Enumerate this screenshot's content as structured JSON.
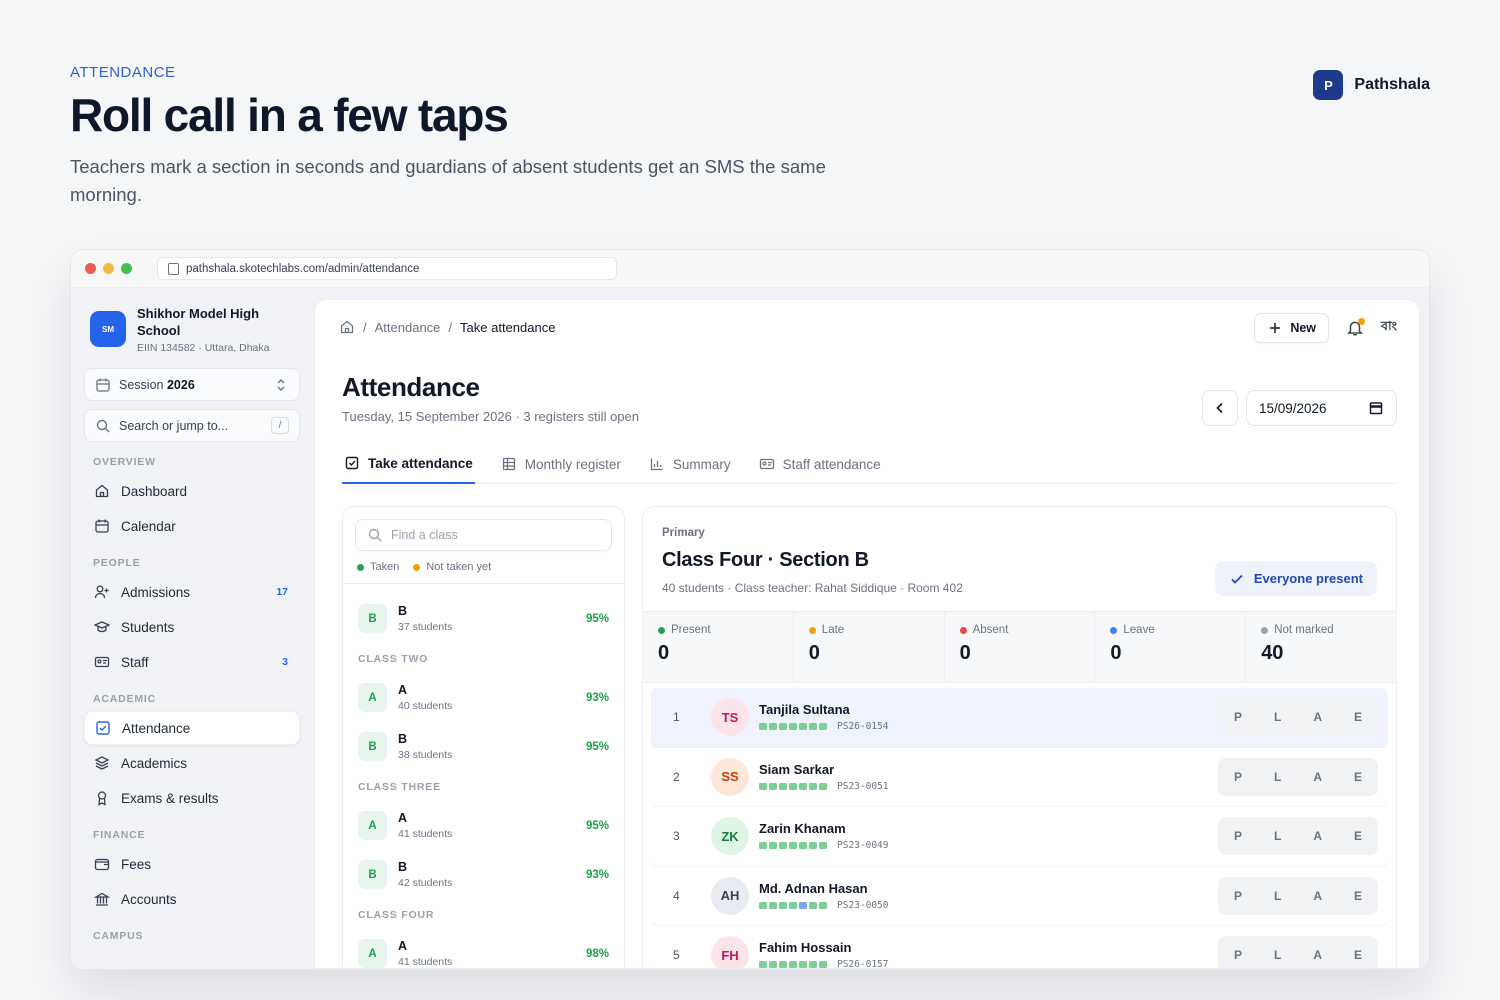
{
  "hero": {
    "eyebrow": "ATTENDANCE",
    "title": "Roll call in a few taps",
    "subtitle": "Teachers mark a section in seconds and guardians of absent students get an SMS the same morning."
  },
  "brand": {
    "logo_letter": "P",
    "name": "Pathshala"
  },
  "browser": {
    "url": "pathshala.skotechlabs.com/admin/attendance"
  },
  "sidebar": {
    "school": {
      "logo_text": "SM",
      "name": "Shikhor Model High School",
      "meta": "EIIN 134582 · Uttara, Dhaka"
    },
    "session": {
      "prefix": "Session",
      "value": "2026"
    },
    "search": {
      "placeholder": "Search or jump to...",
      "shortcut": "/"
    },
    "groups": {
      "overview": "OVERVIEW",
      "people": "PEOPLE",
      "academic": "ACADEMIC",
      "finance": "FINANCE",
      "campus": "CAMPUS"
    },
    "items": {
      "dashboard": "Dashboard",
      "calendar": "Calendar",
      "admissions": "Admissions",
      "admissions_badge": "17",
      "students": "Students",
      "staff": "Staff",
      "staff_badge": "3",
      "attendance": "Attendance",
      "academics": "Academics",
      "exams": "Exams & results",
      "fees": "Fees",
      "accounts": "Accounts"
    }
  },
  "header": {
    "breadcrumb": [
      "Attendance",
      "Take attendance"
    ],
    "new_label": "New",
    "lang_label": "বাং"
  },
  "page": {
    "title": "Attendance",
    "subtitle": "Tuesday, 15 September 2026 · 3 registers still open",
    "date": "15/09/2026"
  },
  "tabs": [
    "Take attendance",
    "Monthly register",
    "Summary",
    "Staff attendance"
  ],
  "classes": {
    "search_placeholder": "Find a class",
    "legend": {
      "taken": "Taken",
      "not_taken": "Not taken yet"
    },
    "colors": {
      "taken": "#22a55a",
      "not_taken": "#f59e0b"
    },
    "top_row": {
      "section": "B",
      "count": "37 students",
      "pct": "95%"
    },
    "groups": [
      {
        "name": "CLASS TWO",
        "rows": [
          {
            "section": "A",
            "count": "40 students",
            "pct": "93%"
          },
          {
            "section": "B",
            "count": "38 students",
            "pct": "95%"
          }
        ]
      },
      {
        "name": "CLASS THREE",
        "rows": [
          {
            "section": "A",
            "count": "41 students",
            "pct": "95%"
          },
          {
            "section": "B",
            "count": "42 students",
            "pct": "93%"
          }
        ]
      },
      {
        "name": "CLASS FOUR",
        "rows": [
          {
            "section": "A",
            "count": "41 students",
            "pct": "98%"
          }
        ]
      }
    ]
  },
  "section": {
    "level": "Primary",
    "title": "Class Four · Section B",
    "meta": "40 students · Class teacher: Rahat Siddique · Room 402",
    "everyone_label": "Everyone present",
    "stats": [
      {
        "label": "Present",
        "value": "0",
        "color": "#22a55a"
      },
      {
        "label": "Late",
        "value": "0",
        "color": "#f59e0b"
      },
      {
        "label": "Absent",
        "value": "0",
        "color": "#ef4444"
      },
      {
        "label": "Leave",
        "value": "0",
        "color": "#3b82f6"
      },
      {
        "label": "Not marked",
        "value": "40",
        "color": "#9ca3af"
      }
    ],
    "status_buttons": [
      "P",
      "L",
      "A",
      "E"
    ],
    "students": [
      {
        "num": "1",
        "initials": "TS",
        "name": "Tanjila Sultana",
        "id": "PS26-0154",
        "avatar_bg": "#fde4e8",
        "avatar_fg": "#be185d",
        "streak_blue_at": -1
      },
      {
        "num": "2",
        "initials": "SS",
        "name": "Siam Sarkar",
        "id": "PS23-0051",
        "avatar_bg": "#fde7d8",
        "avatar_fg": "#c2410c",
        "streak_blue_at": -1
      },
      {
        "num": "3",
        "initials": "ZK",
        "name": "Zarin Khanam",
        "id": "PS23-0049",
        "avatar_bg": "#def5e5",
        "avatar_fg": "#15803d",
        "streak_blue_at": -1
      },
      {
        "num": "4",
        "initials": "AH",
        "name": "Md. Adnan Hasan",
        "id": "PS23-0050",
        "avatar_bg": "#e8ebf0",
        "avatar_fg": "#374151",
        "streak_blue_at": 4
      },
      {
        "num": "5",
        "initials": "FH",
        "name": "Fahim Hossain",
        "id": "PS26-0157",
        "avatar_bg": "#fde4e8",
        "avatar_fg": "#be185d",
        "streak_blue_at": -1
      }
    ]
  }
}
